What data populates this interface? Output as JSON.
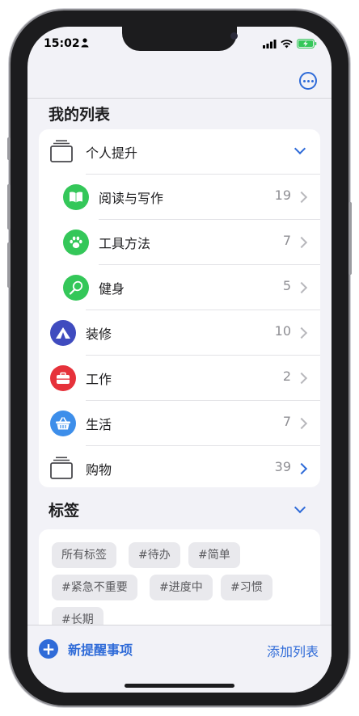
{
  "status_bar": {
    "time": "15:02"
  },
  "sections": {
    "my_lists_title": "我的列表",
    "tags_title": "标签"
  },
  "lists": [
    {
      "label": "个人提升",
      "count": "",
      "icon": "stack-icon",
      "color": "#6c6c70"
    },
    {
      "label": "阅读与写作",
      "count": "19",
      "icon": "book-icon",
      "color": "#34c759"
    },
    {
      "label": "工具方法",
      "count": "7",
      "icon": "paw-icon",
      "color": "#34c759"
    },
    {
      "label": "健身",
      "count": "5",
      "icon": "tennis-racket-icon",
      "color": "#34c759"
    },
    {
      "label": "装修",
      "count": "10",
      "icon": "tent-icon",
      "color": "#3f4bbf"
    },
    {
      "label": "工作",
      "count": "2",
      "icon": "briefcase-icon",
      "color": "#e6323b"
    },
    {
      "label": "生活",
      "count": "7",
      "icon": "basket-icon",
      "color": "#3d8eea"
    },
    {
      "label": "购物",
      "count": "39",
      "icon": "stack-icon",
      "color": "#6c6c70"
    }
  ],
  "tags": [
    "所有标签",
    "#待办",
    "#简单",
    "#紧急不重要",
    "#进度中",
    "#习惯",
    "#长期"
  ],
  "bottom": {
    "new_reminder": "新提醒事项",
    "add_list": "添加列表"
  }
}
